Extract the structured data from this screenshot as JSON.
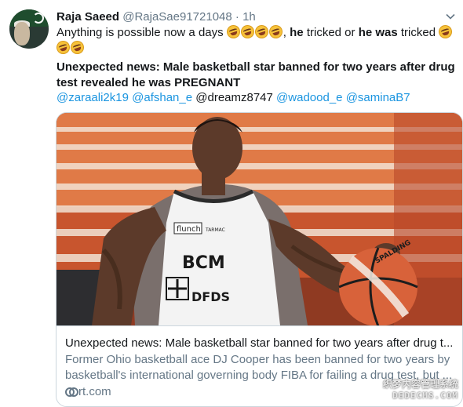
{
  "tweet": {
    "author_name": "Raja Saeed",
    "author_handle": "@RajaSae91721048",
    "dot": "·",
    "time": "1h",
    "avatar_icon": "avatar-flag-quote",
    "menu_icon": "chevron-down-icon",
    "text_part1": "Anything is possible now a days",
    "emoji_name": "rolling-on-floor-laughing",
    "text_he_1": "he",
    "text_tricked_or": " tricked or ",
    "text_he_was": "he was",
    "text_tricked": " tricked ",
    "headline": "Unexpected news: Male basketball star banned for two years after drug test revealed he was PREGNANT",
    "mentions": [
      {
        "text": "@zaraali2k19",
        "linked": true
      },
      {
        "text": "@afshan_e",
        "linked": true
      },
      {
        "text": "@dreamz8747",
        "linked": false
      },
      {
        "text": "@wadood_e",
        "linked": true
      },
      {
        "text": "@saminaB7",
        "linked": true
      }
    ]
  },
  "card": {
    "title": "Unexpected news: Male basketball star banned for two years after drug t...",
    "description": "Former Ohio basketball ace DJ Cooper has been banned for two years by basketball's international governing body FIBA for failing a drug test, but ...",
    "domain": "rt.com",
    "image_jersey_brand": "flunch",
    "image_jersey_sponsor": "TARMAC",
    "image_jersey_team": "BCM",
    "image_jersey_bottom": "DFDS",
    "image_ball_brand": "SPALDING"
  },
  "watermark": {
    "line1": "织梦内容管理系统",
    "line2": "DEDECMS.COM"
  },
  "colors": {
    "link": "#1b95e0",
    "secondary_text": "#657786",
    "border": "#ccd6dd"
  }
}
